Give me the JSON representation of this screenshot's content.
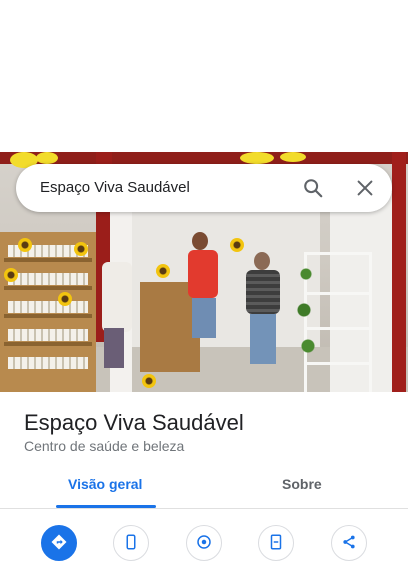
{
  "search": {
    "query": "Espaço Viva Saudável"
  },
  "place": {
    "name": "Espaço Viva Saudável",
    "category": "Centro de saúde e beleza"
  },
  "tabs": [
    {
      "label": "Visão geral",
      "active": true
    },
    {
      "label": "Sobre",
      "active": false
    }
  ],
  "actions": [
    {
      "icon": "directions-icon"
    },
    {
      "icon": "phone-icon"
    },
    {
      "icon": "location-icon"
    },
    {
      "icon": "save-icon"
    },
    {
      "icon": "share-icon"
    }
  ],
  "colors": {
    "accent": "#1a73e8",
    "text_primary": "#202124",
    "text_secondary": "#70757a"
  }
}
